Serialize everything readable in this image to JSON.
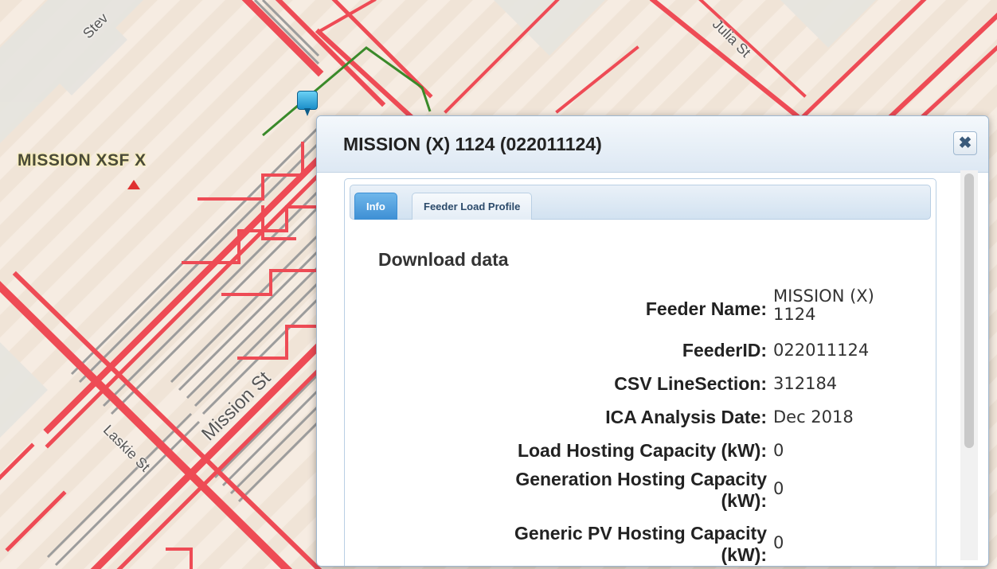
{
  "map": {
    "substation_label": "MISSION XSF X",
    "streets": {
      "mission": "Mission St",
      "lasalle": "Laskie St",
      "julia": "Julia St",
      "stev": "Stev"
    }
  },
  "popup": {
    "title": "MISSION (X) 1124 (022011124)",
    "close_icon": "close-icon",
    "tabs": [
      "Info",
      "Feeder Load Profile"
    ],
    "active_tab": "Info",
    "download_label": "Download data",
    "fields": [
      {
        "label": "Feeder Name:",
        "value": "MISSION (X) 1124"
      },
      {
        "label": "FeederID:",
        "value": "022011124"
      },
      {
        "label": "CSV LineSection:",
        "value": "312184"
      },
      {
        "label": "ICA Analysis Date:",
        "value": "Dec 2018"
      },
      {
        "label": "Load Hosting Capacity (kW):",
        "value": "0"
      },
      {
        "label": "Generation Hosting Capacity (kW):",
        "value": "0"
      },
      {
        "label": "Generic PV Hosting Capacity (kW):",
        "value": "0"
      }
    ]
  },
  "colors": {
    "feeder_line": "#ee4b55",
    "other_line": "#9c9c9c",
    "green_line": "#3a8a2a",
    "tab_active": "#3d8fd4"
  }
}
